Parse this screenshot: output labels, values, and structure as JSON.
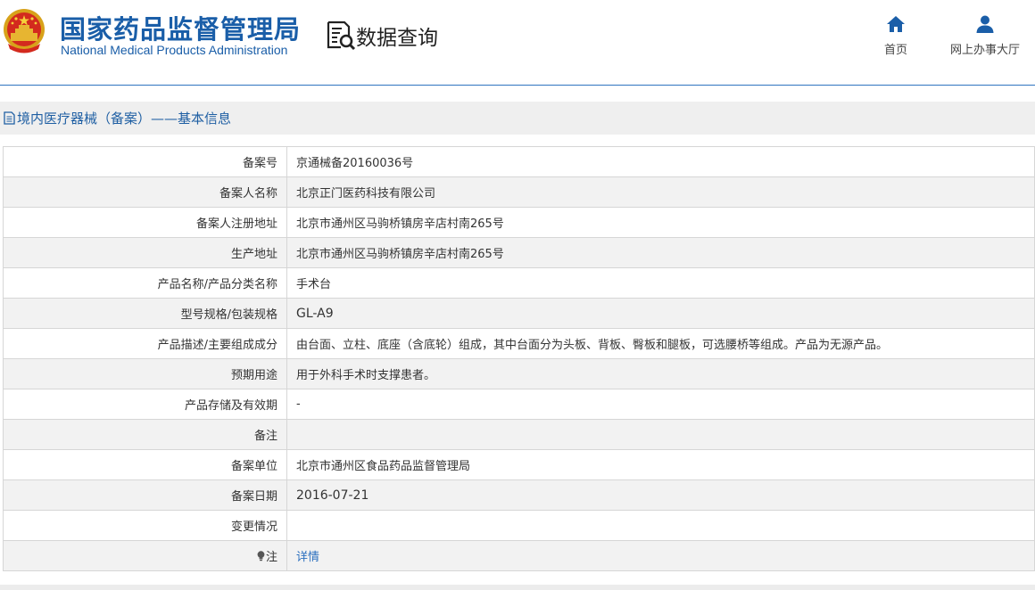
{
  "header": {
    "brand_cn": "国家药品监督管理局",
    "brand_en": "National Medical Products Administration",
    "query_label": "数据查询",
    "nav": [
      {
        "label": "首页",
        "icon": "home-icon"
      },
      {
        "label": "网上办事大厅",
        "icon": "user-icon"
      }
    ]
  },
  "section": {
    "title": "境内医疗器械（备案）——基本信息",
    "icon": "document-icon"
  },
  "rows": [
    {
      "label": "备案号",
      "value": "京通械备20160036号"
    },
    {
      "label": "备案人名称",
      "value": "北京正门医药科技有限公司"
    },
    {
      "label": "备案人注册地址",
      "value": "北京市通州区马驹桥镇房辛店村南265号"
    },
    {
      "label": "生产地址",
      "value": "北京市通州区马驹桥镇房辛店村南265号"
    },
    {
      "label": "产品名称/产品分类名称",
      "value": "手术台"
    },
    {
      "label": "型号规格/包装规格",
      "value": "GL-A9"
    },
    {
      "label": "产品描述/主要组成成分",
      "value": "由台面、立柱、底座（含底轮）组成，其中台面分为头板、背板、臀板和腿板，可选腰桥等组成。产品为无源产品。"
    },
    {
      "label": "预期用途",
      "value": "用于外科手术时支撑患者。"
    },
    {
      "label": "产品存储及有效期",
      "value": "-"
    },
    {
      "label": "备注",
      "value": ""
    },
    {
      "label": "备案单位",
      "value": "北京市通州区食品药品监督管理局"
    },
    {
      "label": "备案日期",
      "value": "2016-07-21"
    },
    {
      "label": "变更情况",
      "value": ""
    }
  ],
  "note_row": {
    "label": "注",
    "icon": "lightbulb-icon",
    "link_text": "详情"
  },
  "colors": {
    "brand_blue": "#1a5ea8",
    "link_blue": "#2a6fbf",
    "title_bar_bg": "#efefef",
    "row_alt_bg": "#f2f2f2"
  }
}
